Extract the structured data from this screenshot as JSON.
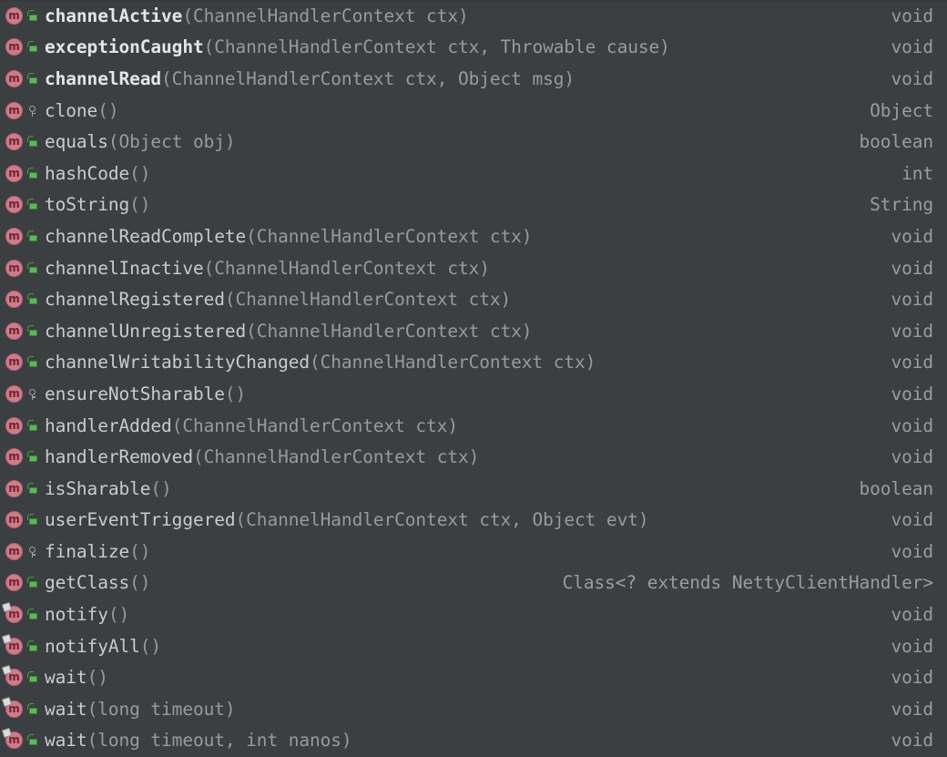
{
  "panel": {
    "name": "structure-member-list",
    "background_color": "#3c3f41",
    "owner_class": "NettyClientHandler",
    "icon_names": {
      "method": "method-icon",
      "public": "public-unlock-icon",
      "protected": "protected-key-icon",
      "final_badge": "final-marker-badge"
    },
    "method_glyph": "m",
    "colors": {
      "method_icon": "#cf7b8b",
      "public_icon": "#5cb85a",
      "protected_icon": "#9b9da0",
      "member_name": "#c9cbcc",
      "declared_member_name": "#e3e5e6",
      "params": "#989a9c",
      "return_type": "#9a9c9e"
    }
  },
  "members": [
    {
      "name": "channelActive",
      "params": "(ChannelHandlerContext ctx)",
      "return": "void",
      "visibility": "public",
      "declared": true,
      "final": false
    },
    {
      "name": "exceptionCaught",
      "params": "(ChannelHandlerContext ctx, Throwable cause)",
      "return": "void",
      "visibility": "public",
      "declared": true,
      "final": false
    },
    {
      "name": "channelRead",
      "params": "(ChannelHandlerContext ctx, Object msg)",
      "return": "void",
      "visibility": "public",
      "declared": true,
      "final": false
    },
    {
      "name": "clone",
      "params": "()",
      "return": "Object",
      "visibility": "protected",
      "declared": false,
      "final": false
    },
    {
      "name": "equals",
      "params": "(Object obj)",
      "return": "boolean",
      "visibility": "public",
      "declared": false,
      "final": false
    },
    {
      "name": "hashCode",
      "params": "()",
      "return": "int",
      "visibility": "public",
      "declared": false,
      "final": false
    },
    {
      "name": "toString",
      "params": "()",
      "return": "String",
      "visibility": "public",
      "declared": false,
      "final": false
    },
    {
      "name": "channelReadComplete",
      "params": "(ChannelHandlerContext ctx)",
      "return": "void",
      "visibility": "public",
      "declared": false,
      "final": false
    },
    {
      "name": "channelInactive",
      "params": "(ChannelHandlerContext ctx)",
      "return": "void",
      "visibility": "public",
      "declared": false,
      "final": false
    },
    {
      "name": "channelRegistered",
      "params": "(ChannelHandlerContext ctx)",
      "return": "void",
      "visibility": "public",
      "declared": false,
      "final": false
    },
    {
      "name": "channelUnregistered",
      "params": "(ChannelHandlerContext ctx)",
      "return": "void",
      "visibility": "public",
      "declared": false,
      "final": false
    },
    {
      "name": "channelWritabilityChanged",
      "params": "(ChannelHandlerContext ctx)",
      "return": "void",
      "visibility": "public",
      "declared": false,
      "final": false
    },
    {
      "name": "ensureNotSharable",
      "params": "()",
      "return": "void",
      "visibility": "protected",
      "declared": false,
      "final": false
    },
    {
      "name": "handlerAdded",
      "params": "(ChannelHandlerContext ctx)",
      "return": "void",
      "visibility": "public",
      "declared": false,
      "final": false
    },
    {
      "name": "handlerRemoved",
      "params": "(ChannelHandlerContext ctx)",
      "return": "void",
      "visibility": "public",
      "declared": false,
      "final": false
    },
    {
      "name": "isSharable",
      "params": "()",
      "return": "boolean",
      "visibility": "public",
      "declared": false,
      "final": false
    },
    {
      "name": "userEventTriggered",
      "params": "(ChannelHandlerContext ctx, Object evt)",
      "return": "void",
      "visibility": "public",
      "declared": false,
      "final": false
    },
    {
      "name": "finalize",
      "params": "()",
      "return": "void",
      "visibility": "protected",
      "declared": false,
      "final": false
    },
    {
      "name": "getClass",
      "params": "()",
      "return": "Class<? extends NettyClientHandler>",
      "visibility": "public",
      "declared": false,
      "final": false
    },
    {
      "name": "notify",
      "params": "()",
      "return": "void",
      "visibility": "public",
      "declared": false,
      "final": true
    },
    {
      "name": "notifyAll",
      "params": "()",
      "return": "void",
      "visibility": "public",
      "declared": false,
      "final": true
    },
    {
      "name": "wait",
      "params": "()",
      "return": "void",
      "visibility": "public",
      "declared": false,
      "final": true
    },
    {
      "name": "wait",
      "params": "(long timeout)",
      "return": "void",
      "visibility": "public",
      "declared": false,
      "final": true
    },
    {
      "name": "wait",
      "params": "(long timeout, int nanos)",
      "return": "void",
      "visibility": "public",
      "declared": false,
      "final": true
    }
  ]
}
